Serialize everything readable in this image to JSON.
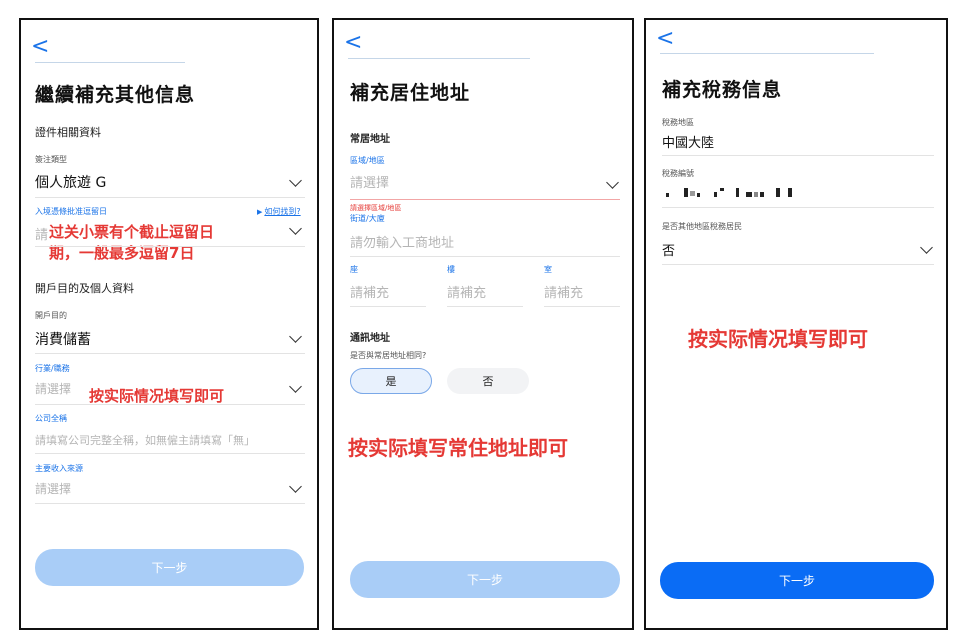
{
  "left": {
    "back": "<",
    "title": "繼續補充其他信息",
    "section_docs": "證件相關資料",
    "visa_type": {
      "label": "簽注類型",
      "value": "個人旅遊 G"
    },
    "entry_deadline": {
      "label": "入境憑條批准逗留日",
      "link": "如何找到?",
      "placeholder": "請"
    },
    "annotation1_line1": "过关小票有个截止逗留日",
    "annotation1_line2": "期，一般最多逗留7日",
    "section_purpose": "開戶目的及個人資料",
    "purpose": {
      "label": "開戶目的",
      "value": "消費儲蓄"
    },
    "occupation": {
      "label": "行業/職務",
      "placeholder": "請選擇"
    },
    "annotation2": "按实际情况填写即可",
    "company": {
      "label": "公司全稱",
      "placeholder": "請填寫公司完整全稱，如無僱主請填寫「無」"
    },
    "income": {
      "label": "主要收入來源",
      "placeholder": "請選擇"
    },
    "next": "下一步"
  },
  "middle": {
    "back": "<",
    "title": "補充居住地址",
    "section_residence": "常居地址",
    "region": {
      "label": "區域/地區",
      "placeholder": "請選擇",
      "error": "請選擇區域/地區"
    },
    "street": {
      "label": "街道/大廈",
      "placeholder": "請勿輸入工商地址"
    },
    "block": {
      "label": "座",
      "placeholder": "請補充"
    },
    "floor": {
      "label": "樓",
      "placeholder": "請補充"
    },
    "room": {
      "label": "室",
      "placeholder": "請補充"
    },
    "section_mail": "通訊地址",
    "same_question": "是否與常居地址相同?",
    "yes": "是",
    "no": "否",
    "annotation": "按实际填写常住地址即可",
    "next": "下一步"
  },
  "right": {
    "back": "<",
    "title": "補充稅務信息",
    "tax_region": {
      "label": "稅務地區",
      "value": "中國大陸"
    },
    "tax_number": {
      "label": "稅務編號"
    },
    "other_resident": {
      "label": "是否其他地區稅務居民",
      "value": "否"
    },
    "annotation": "按实际情况填写即可",
    "next": "下一步"
  },
  "colors": {
    "accent": "#1a73e8",
    "annotation_red": "#e53935",
    "button_disabled": "#a9cdf7",
    "button_active": "#0a6cf5"
  }
}
